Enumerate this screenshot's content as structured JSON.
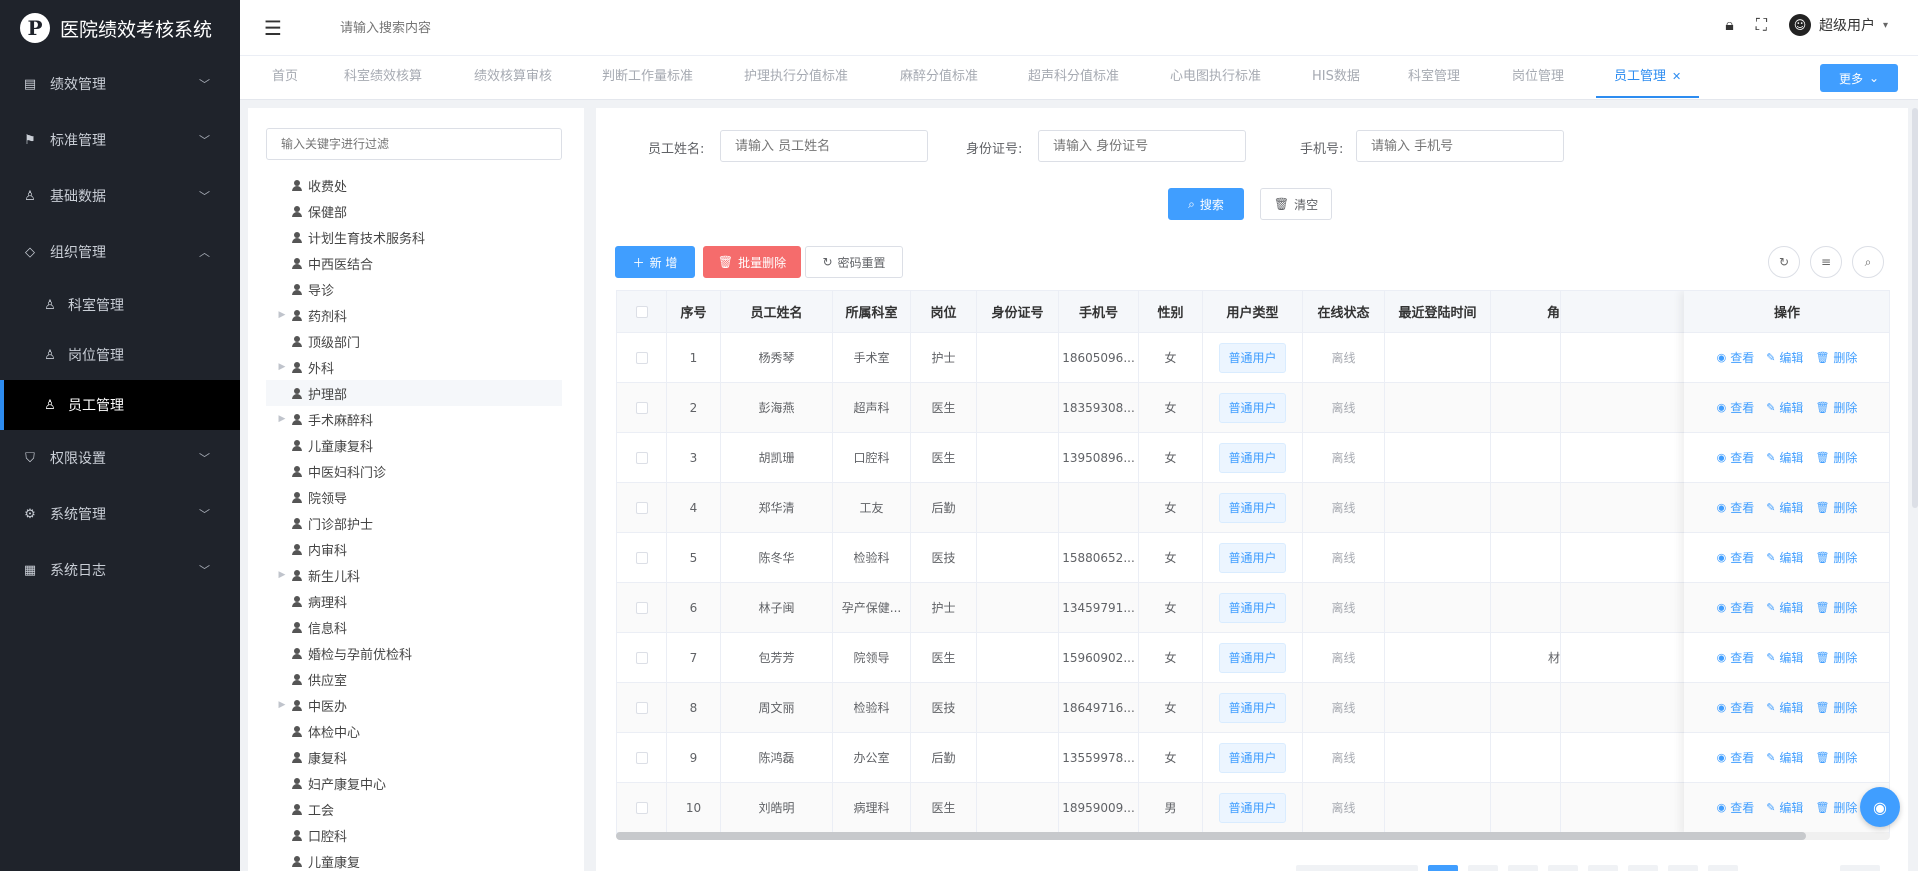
{
  "app": {
    "logo_letter": "P",
    "title": "医院绩效考核系统"
  },
  "sidebar": {
    "items": [
      {
        "label": "绩效管理",
        "icon": "document-icon"
      },
      {
        "label": "标准管理",
        "icon": "flag-icon"
      },
      {
        "label": "基础数据",
        "icon": "user-icon"
      },
      {
        "label": "组织管理",
        "icon": "tag-icon"
      },
      {
        "label": "权限设置",
        "icon": "shield-icon"
      },
      {
        "label": "系统管理",
        "icon": "gear-icon"
      },
      {
        "label": "系统日志",
        "icon": "log-icon"
      }
    ],
    "sub_items": [
      {
        "label": "科室管理"
      },
      {
        "label": "岗位管理"
      },
      {
        "label": "员工管理"
      }
    ]
  },
  "header": {
    "search_placeholder": "请输入搜索内容",
    "username": "超级用户"
  },
  "tabs": [
    "首页",
    "科室绩效核算",
    "绩效核算审核",
    "判断工作量标准",
    "护理执行分值标准",
    "麻醉分值标准",
    "超声科分值标准",
    "心电图执行标准",
    "HIS数据",
    "科室管理",
    "岗位管理",
    "员工管理"
  ],
  "more_label": "更多",
  "tree": {
    "filter_placeholder": "输入关键字进行过滤",
    "nodes": [
      {
        "label": "收费处",
        "expandable": false
      },
      {
        "label": "保健部",
        "expandable": false
      },
      {
        "label": "计划生育技术服务科",
        "expandable": false
      },
      {
        "label": "中西医结合",
        "expandable": false
      },
      {
        "label": "导诊",
        "expandable": false
      },
      {
        "label": "药剂科",
        "expandable": true
      },
      {
        "label": "顶级部门",
        "expandable": false
      },
      {
        "label": "外科",
        "expandable": true
      },
      {
        "label": "护理部",
        "expandable": false
      },
      {
        "label": "手术麻醉科",
        "expandable": true
      },
      {
        "label": "儿童康复科",
        "expandable": false
      },
      {
        "label": "中医妇科门诊",
        "expandable": false
      },
      {
        "label": "院领导",
        "expandable": false
      },
      {
        "label": "门诊部护士",
        "expandable": false
      },
      {
        "label": "内审科",
        "expandable": false
      },
      {
        "label": "新生儿科",
        "expandable": true
      },
      {
        "label": "病理科",
        "expandable": false
      },
      {
        "label": "信息科",
        "expandable": false
      },
      {
        "label": "婚检与孕前优检科",
        "expandable": false
      },
      {
        "label": "供应室",
        "expandable": false
      },
      {
        "label": "中医办",
        "expandable": true
      },
      {
        "label": "体检中心",
        "expandable": false
      },
      {
        "label": "康复科",
        "expandable": false
      },
      {
        "label": "妇产康复中心",
        "expandable": false
      },
      {
        "label": "工会",
        "expandable": false
      },
      {
        "label": "口腔科",
        "expandable": false
      },
      {
        "label": "儿童康复",
        "expandable": false
      }
    ]
  },
  "form": {
    "name_label": "员工姓名:",
    "name_placeholder": "请输入 员工姓名",
    "id_label": "身份证号:",
    "id_placeholder": "请输入 身份证号",
    "phone_label": "手机号:",
    "phone_placeholder": "请输入 手机号",
    "search_label": "搜索",
    "clear_label": "清空"
  },
  "toolbar": {
    "add_label": "新 增",
    "batch_delete_label": "批量删除",
    "reset_pwd_label": "密码重置"
  },
  "table": {
    "headers": [
      "序号",
      "员工姓名",
      "所属科室",
      "岗位",
      "身份证号",
      "手机号",
      "性别",
      "用户类型",
      "在线状态",
      "最近登陆时间",
      "角",
      "操作"
    ],
    "op_view": "查看",
    "op_edit": "编辑",
    "op_delete": "删除",
    "rows": [
      {
        "no": "1",
        "name": "杨秀琴",
        "dept": "手术室",
        "post": "护士",
        "id": "",
        "phone": "18605096...",
        "sex": "女",
        "type": "普通用户",
        "status": "离线",
        "last": "",
        "role": ""
      },
      {
        "no": "2",
        "name": "彭海燕",
        "dept": "超声科",
        "post": "医生",
        "id": "",
        "phone": "18359308...",
        "sex": "女",
        "type": "普通用户",
        "status": "离线",
        "last": "",
        "role": ""
      },
      {
        "no": "3",
        "name": "胡凯珊",
        "dept": "口腔科",
        "post": "医生",
        "id": "",
        "phone": "13950896...",
        "sex": "女",
        "type": "普通用户",
        "status": "离线",
        "last": "",
        "role": ""
      },
      {
        "no": "4",
        "name": "郑华清",
        "dept": "工友",
        "post": "后勤",
        "id": "",
        "phone": "",
        "sex": "女",
        "type": "普通用户",
        "status": "离线",
        "last": "",
        "role": ""
      },
      {
        "no": "5",
        "name": "陈冬华",
        "dept": "检验科",
        "post": "医技",
        "id": "",
        "phone": "15880652...",
        "sex": "女",
        "type": "普通用户",
        "status": "离线",
        "last": "",
        "role": ""
      },
      {
        "no": "6",
        "name": "林子闽",
        "dept": "孕产保健...",
        "post": "护士",
        "id": "",
        "phone": "13459791...",
        "sex": "女",
        "type": "普通用户",
        "status": "离线",
        "last": "",
        "role": ""
      },
      {
        "no": "7",
        "name": "包芳芳",
        "dept": "院领导",
        "post": "医生",
        "id": "",
        "phone": "15960902...",
        "sex": "女",
        "type": "普通用户",
        "status": "离线",
        "last": "",
        "role": "材"
      },
      {
        "no": "8",
        "name": "周文丽",
        "dept": "检验科",
        "post": "医技",
        "id": "",
        "phone": "18649716...",
        "sex": "女",
        "type": "普通用户",
        "status": "离线",
        "last": "",
        "role": ""
      },
      {
        "no": "9",
        "name": "陈鸿磊",
        "dept": "办公室",
        "post": "后勤",
        "id": "",
        "phone": "13559978...",
        "sex": "女",
        "type": "普通用户",
        "status": "离线",
        "last": "",
        "role": ""
      },
      {
        "no": "10",
        "name": "刘皓明",
        "dept": "病理科",
        "post": "医生",
        "id": "",
        "phone": "18959009...",
        "sex": "男",
        "type": "普通用户",
        "status": "离线",
        "last": "",
        "role": ""
      }
    ]
  },
  "colors": {
    "sidebar_bg": "#1f232b",
    "accent": "#409eff",
    "danger": "#f56c6c"
  }
}
